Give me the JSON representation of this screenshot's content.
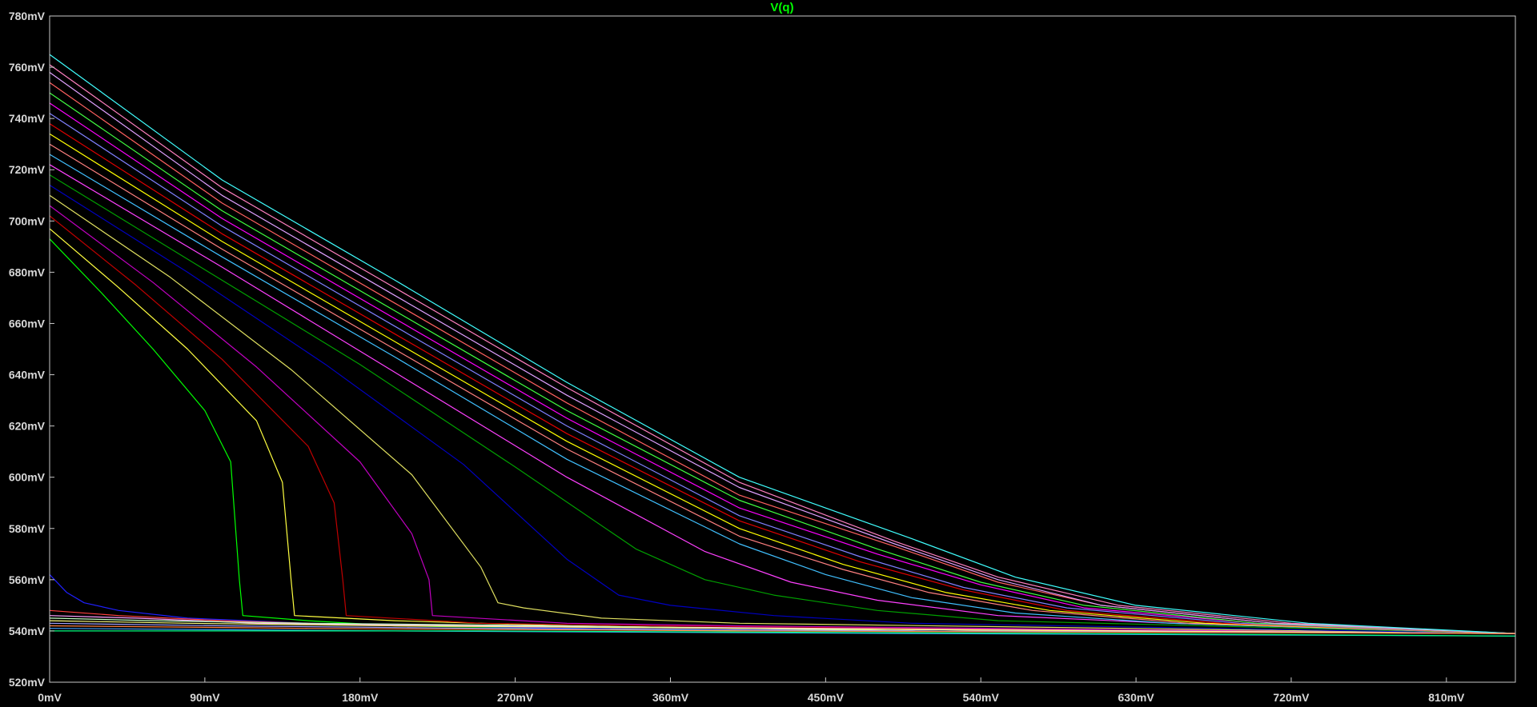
{
  "chart_data": {
    "type": "line",
    "title": "V(q)",
    "xlim": [
      0,
      850
    ],
    "ylim": [
      520,
      780
    ],
    "x_ticks": [
      "0mV",
      "90mV",
      "180mV",
      "270mV",
      "360mV",
      "450mV",
      "540mV",
      "630mV",
      "720mV",
      "810mV"
    ],
    "y_ticks": [
      "520mV",
      "540mV",
      "560mV",
      "580mV",
      "600mV",
      "620mV",
      "640mV",
      "660mV",
      "680mV",
      "700mV",
      "720mV",
      "740mV",
      "760mV",
      "780mV"
    ],
    "grid": false,
    "background": "#000000",
    "axis_color": "#c8c8c8",
    "title_color": "#00ff00",
    "series": [
      {
        "color": "#00ff00",
        "points": [
          [
            0,
            693
          ],
          [
            30,
            672
          ],
          [
            60,
            650
          ],
          [
            90,
            626
          ],
          [
            105,
            606
          ],
          [
            110,
            560
          ],
          [
            112,
            546
          ],
          [
            150,
            544
          ],
          [
            200,
            542
          ],
          [
            300,
            541
          ],
          [
            400,
            540
          ],
          [
            850,
            539
          ]
        ]
      },
      {
        "color": "#ffff40",
        "points": [
          [
            0,
            697
          ],
          [
            40,
            674
          ],
          [
            80,
            650
          ],
          [
            120,
            622
          ],
          [
            135,
            598
          ],
          [
            140,
            560
          ],
          [
            142,
            546
          ],
          [
            200,
            544
          ],
          [
            300,
            542
          ],
          [
            400,
            541
          ],
          [
            850,
            539
          ]
        ]
      },
      {
        "color": "#c00000",
        "points": [
          [
            0,
            702
          ],
          [
            50,
            675
          ],
          [
            100,
            646
          ],
          [
            150,
            612
          ],
          [
            165,
            590
          ],
          [
            170,
            560
          ],
          [
            172,
            546
          ],
          [
            250,
            543
          ],
          [
            350,
            542
          ],
          [
            850,
            539
          ]
        ]
      },
      {
        "color": "#c000c0",
        "points": [
          [
            0,
            706
          ],
          [
            60,
            676
          ],
          [
            120,
            643
          ],
          [
            180,
            606
          ],
          [
            210,
            578
          ],
          [
            220,
            560
          ],
          [
            222,
            546
          ],
          [
            300,
            543
          ],
          [
            400,
            542
          ],
          [
            850,
            539
          ]
        ]
      },
      {
        "color": "#e0e060",
        "points": [
          [
            0,
            710
          ],
          [
            70,
            678
          ],
          [
            140,
            642
          ],
          [
            210,
            601
          ],
          [
            250,
            565
          ],
          [
            260,
            551
          ],
          [
            275,
            549
          ],
          [
            320,
            545
          ],
          [
            400,
            543
          ],
          [
            850,
            539
          ]
        ]
      },
      {
        "color": "#0000c0",
        "points": [
          [
            0,
            714
          ],
          [
            80,
            680
          ],
          [
            160,
            644
          ],
          [
            240,
            605
          ],
          [
            300,
            568
          ],
          [
            330,
            554
          ],
          [
            360,
            550
          ],
          [
            420,
            546
          ],
          [
            500,
            543
          ],
          [
            850,
            539
          ]
        ]
      },
      {
        "color": "#00a000",
        "points": [
          [
            0,
            718
          ],
          [
            90,
            681
          ],
          [
            180,
            644
          ],
          [
            270,
            604
          ],
          [
            340,
            572
          ],
          [
            380,
            560
          ],
          [
            420,
            554
          ],
          [
            480,
            548
          ],
          [
            550,
            544
          ],
          [
            850,
            539
          ]
        ]
      },
      {
        "color": "#ff40ff",
        "points": [
          [
            0,
            722
          ],
          [
            100,
            682
          ],
          [
            200,
            641
          ],
          [
            300,
            600
          ],
          [
            380,
            571
          ],
          [
            430,
            559
          ],
          [
            480,
            552
          ],
          [
            550,
            546
          ],
          [
            650,
            543
          ],
          [
            850,
            539
          ]
        ]
      },
      {
        "color": "#40c0ff",
        "points": [
          [
            0,
            726
          ],
          [
            100,
            686
          ],
          [
            200,
            647
          ],
          [
            300,
            607
          ],
          [
            400,
            574
          ],
          [
            450,
            562
          ],
          [
            500,
            553
          ],
          [
            560,
            547
          ],
          [
            650,
            543
          ],
          [
            850,
            539
          ]
        ]
      },
      {
        "color": "#ff8080",
        "points": [
          [
            0,
            730
          ],
          [
            100,
            689
          ],
          [
            200,
            650
          ],
          [
            300,
            611
          ],
          [
            400,
            577
          ],
          [
            460,
            564
          ],
          [
            510,
            555
          ],
          [
            570,
            548
          ],
          [
            660,
            543
          ],
          [
            850,
            539
          ]
        ]
      },
      {
        "color": "#ffff00",
        "points": [
          [
            0,
            734
          ],
          [
            100,
            692
          ],
          [
            200,
            653
          ],
          [
            300,
            614
          ],
          [
            400,
            580
          ],
          [
            460,
            566
          ],
          [
            520,
            555
          ],
          [
            580,
            548
          ],
          [
            670,
            543
          ],
          [
            850,
            539
          ]
        ]
      },
      {
        "color": "#e00000",
        "points": [
          [
            0,
            738
          ],
          [
            100,
            695
          ],
          [
            200,
            656
          ],
          [
            300,
            617
          ],
          [
            400,
            583
          ],
          [
            470,
            567
          ],
          [
            530,
            556
          ],
          [
            590,
            548
          ],
          [
            680,
            543
          ],
          [
            850,
            539
          ]
        ]
      },
      {
        "color": "#8080ff",
        "points": [
          [
            0,
            742
          ],
          [
            100,
            698
          ],
          [
            200,
            659
          ],
          [
            300,
            620
          ],
          [
            400,
            585
          ],
          [
            470,
            569
          ],
          [
            530,
            557
          ],
          [
            590,
            549
          ],
          [
            690,
            543
          ],
          [
            850,
            539
          ]
        ]
      },
      {
        "color": "#ff00ff",
        "points": [
          [
            0,
            746
          ],
          [
            100,
            701
          ],
          [
            200,
            662
          ],
          [
            300,
            623
          ],
          [
            400,
            588
          ],
          [
            480,
            570
          ],
          [
            540,
            558
          ],
          [
            600,
            549
          ],
          [
            700,
            543
          ],
          [
            850,
            539
          ]
        ]
      },
      {
        "color": "#40ff40",
        "points": [
          [
            0,
            750
          ],
          [
            100,
            704
          ],
          [
            200,
            665
          ],
          [
            300,
            626
          ],
          [
            400,
            591
          ],
          [
            480,
            572
          ],
          [
            540,
            559
          ],
          [
            600,
            550
          ],
          [
            700,
            543
          ],
          [
            850,
            539
          ]
        ]
      },
      {
        "color": "#ff6060",
        "points": [
          [
            0,
            754
          ],
          [
            100,
            707
          ],
          [
            200,
            668
          ],
          [
            300,
            629
          ],
          [
            400,
            593
          ],
          [
            490,
            573
          ],
          [
            550,
            559
          ],
          [
            610,
            550
          ],
          [
            710,
            543
          ],
          [
            850,
            539
          ]
        ]
      },
      {
        "color": "#e0a0ff",
        "points": [
          [
            0,
            758
          ],
          [
            100,
            710
          ],
          [
            200,
            671
          ],
          [
            300,
            632
          ],
          [
            400,
            596
          ],
          [
            490,
            574
          ],
          [
            550,
            560
          ],
          [
            610,
            550
          ],
          [
            710,
            543
          ],
          [
            850,
            539
          ]
        ]
      },
      {
        "color": "#ff80c0",
        "points": [
          [
            0,
            761
          ],
          [
            100,
            713
          ],
          [
            200,
            674
          ],
          [
            300,
            635
          ],
          [
            400,
            598
          ],
          [
            490,
            575
          ],
          [
            550,
            561
          ],
          [
            620,
            550
          ],
          [
            720,
            543
          ],
          [
            850,
            539
          ]
        ]
      },
      {
        "color": "#40ffff",
        "points": [
          [
            0,
            765
          ],
          [
            100,
            716
          ],
          [
            200,
            677
          ],
          [
            300,
            637
          ],
          [
            400,
            600
          ],
          [
            500,
            576
          ],
          [
            560,
            561
          ],
          [
            630,
            550
          ],
          [
            730,
            543
          ],
          [
            850,
            539
          ]
        ]
      },
      {
        "color": "#2020ff",
        "points": [
          [
            0,
            562
          ],
          [
            10,
            555
          ],
          [
            20,
            551
          ],
          [
            40,
            548
          ],
          [
            80,
            545
          ],
          [
            150,
            543
          ],
          [
            300,
            541
          ],
          [
            500,
            540
          ],
          [
            850,
            539
          ]
        ]
      },
      {
        "color": "#ff4040",
        "points": [
          [
            0,
            548
          ],
          [
            40,
            546
          ],
          [
            100,
            544
          ],
          [
            200,
            542
          ],
          [
            400,
            541
          ],
          [
            850,
            539
          ]
        ]
      },
      {
        "color": "#ffa0ff",
        "points": [
          [
            0,
            546
          ],
          [
            50,
            545
          ],
          [
            120,
            543
          ],
          [
            250,
            542
          ],
          [
            450,
            541
          ],
          [
            850,
            539
          ]
        ]
      },
      {
        "color": "#c0ffc0",
        "points": [
          [
            0,
            545
          ],
          [
            60,
            544
          ],
          [
            150,
            543
          ],
          [
            300,
            542
          ],
          [
            500,
            540
          ],
          [
            850,
            539
          ]
        ]
      },
      {
        "color": "#ffff80",
        "points": [
          [
            0,
            544
          ],
          [
            80,
            543
          ],
          [
            200,
            542
          ],
          [
            400,
            541
          ],
          [
            850,
            539
          ]
        ]
      },
      {
        "color": "#a0a0ff",
        "points": [
          [
            0,
            543
          ],
          [
            100,
            542
          ],
          [
            250,
            541
          ],
          [
            500,
            540
          ],
          [
            850,
            539
          ]
        ]
      },
      {
        "color": "#ff8040",
        "points": [
          [
            0,
            542
          ],
          [
            150,
            541
          ],
          [
            400,
            540
          ],
          [
            850,
            539
          ]
        ]
      },
      {
        "color": "#40a0ff",
        "points": [
          [
            0,
            541
          ],
          [
            200,
            540
          ],
          [
            500,
            539
          ],
          [
            850,
            538
          ]
        ]
      },
      {
        "color": "#00ff80",
        "points": [
          [
            0,
            540
          ],
          [
            250,
            540
          ],
          [
            600,
            539
          ],
          [
            850,
            538
          ]
        ]
      }
    ]
  }
}
